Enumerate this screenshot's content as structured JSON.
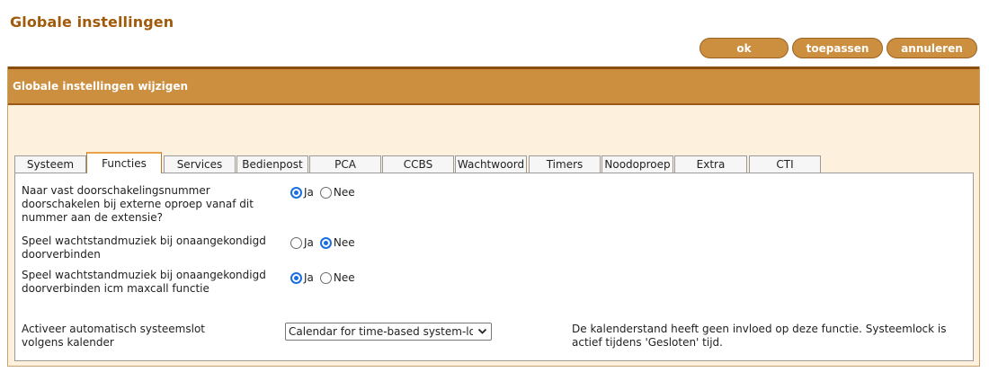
{
  "page": {
    "title": "Globale instellingen"
  },
  "buttons": {
    "ok": "ok",
    "apply": "toepassen",
    "cancel": "annuleren"
  },
  "panel": {
    "title": "Globale instellingen wijzigen"
  },
  "tabs": [
    {
      "label": "Systeem",
      "active": false
    },
    {
      "label": "Functies",
      "active": true
    },
    {
      "label": "Services",
      "active": false
    },
    {
      "label": "Bedienpost",
      "active": false
    },
    {
      "label": "PCA",
      "active": false
    },
    {
      "label": "CCBS",
      "active": false
    },
    {
      "label": "Wachtwoord",
      "active": false
    },
    {
      "label": "Timers",
      "active": false
    },
    {
      "label": "Noodoproep",
      "active": false
    },
    {
      "label": "Extra",
      "active": false
    },
    {
      "label": "CTI",
      "active": false
    }
  ],
  "settings": [
    {
      "label": "Naar vast doorschakelingsnummer doorschakelen bij externe oproep vanaf dit nummer aan de extensie?",
      "yes": "Ja",
      "no": "Nee",
      "value": "Ja"
    },
    {
      "label": "Speel wachtstandmuziek bij onaangekondigd doorverbinden",
      "yes": "Ja",
      "no": "Nee",
      "value": "Nee"
    },
    {
      "label": "Speel wachtstandmuziek bij onaangekondigd doorverbinden icm maxcall functie",
      "yes": "Ja",
      "no": "Nee",
      "value": "Ja"
    }
  ],
  "auto_lock": {
    "label": "Activeer automatisch systeemslot volgens kalender",
    "selected": "Calendar for time-based system-lock",
    "note": "De kalenderstand heeft geen invloed op deze functie. Systeemlock is actief tijdens 'Gesloten' tijd."
  },
  "colors": {
    "title_brown": "#a05a0a",
    "accent_orange": "#cc8f40",
    "panel_bg": "#fdf0dc",
    "radio_blue": "#1a6fe0"
  },
  "icons": {
    "select_arrow": "chevron-down-icon"
  }
}
